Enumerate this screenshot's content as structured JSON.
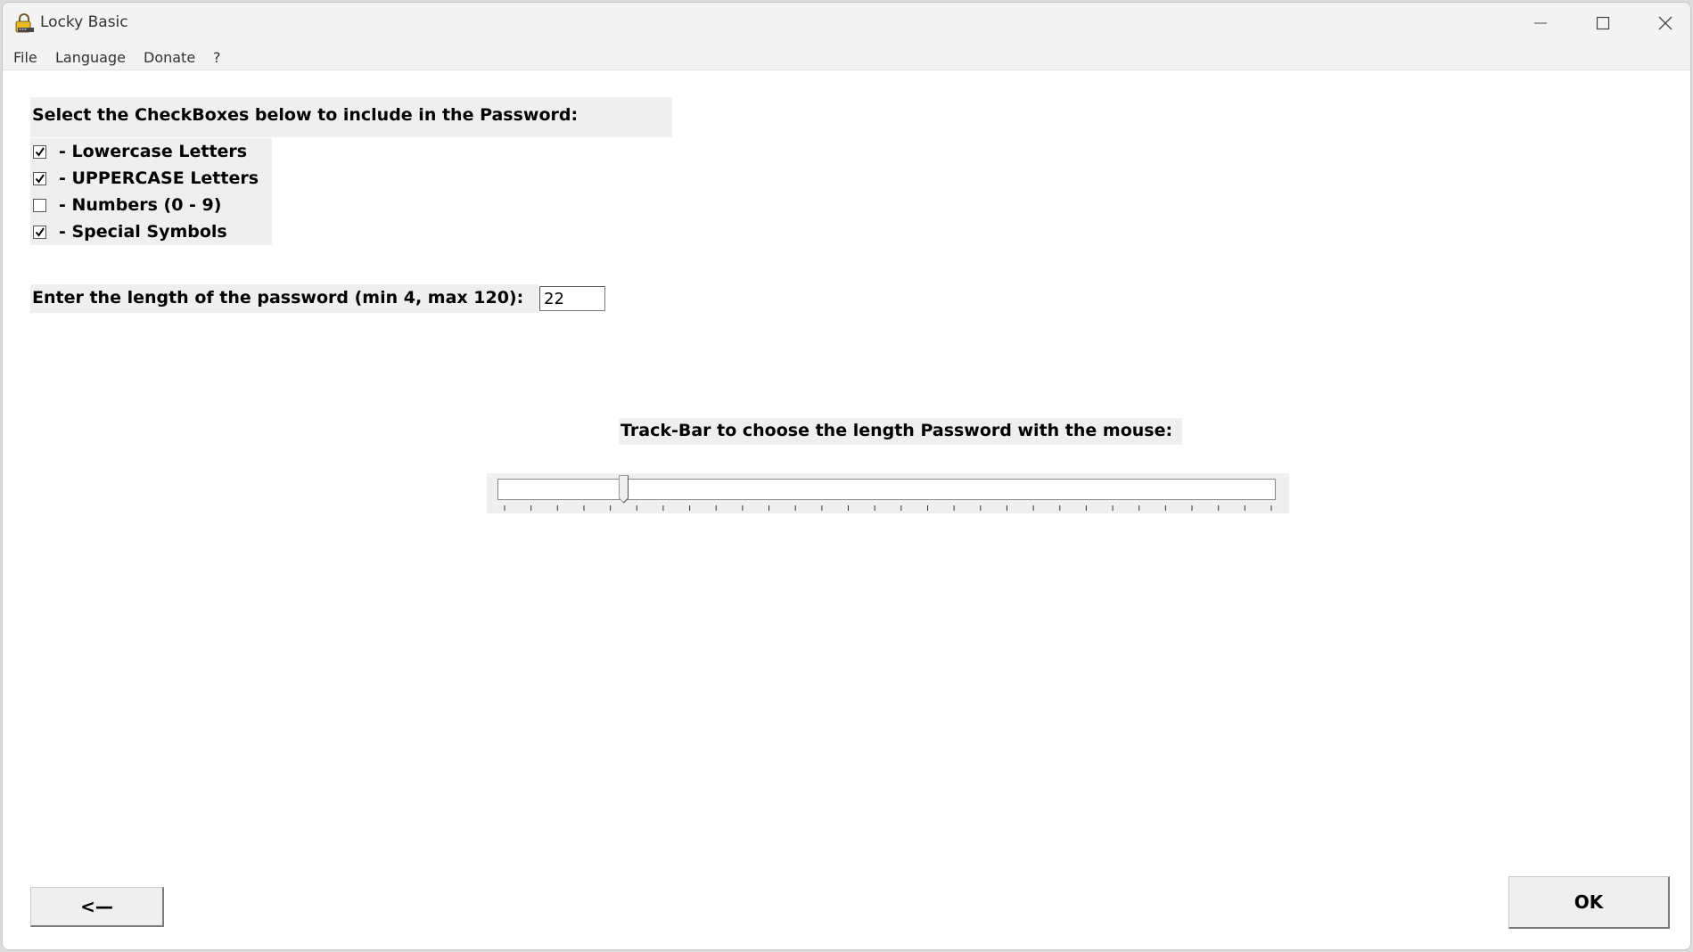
{
  "window": {
    "title": "Locky Basic"
  },
  "menu": [
    "File",
    "Language",
    "Donate",
    "?"
  ],
  "checkbox_section": {
    "heading": "Select the CheckBoxes below to include in the Password:",
    "items": [
      {
        "label": "-  Lowercase Letters",
        "checked": true
      },
      {
        "label": "-  UPPERCASE Letters",
        "checked": true
      },
      {
        "label": "-  Numbers (0 - 9)",
        "checked": false
      },
      {
        "label": "-  Special Symbols",
        "checked": true
      }
    ]
  },
  "length": {
    "label": "Enter the length of the password (min 4, max 120):",
    "value": "22",
    "min": 4,
    "max": 120
  },
  "trackbar": {
    "label": "Track-Bar to choose the length Password with the mouse:",
    "value": 22,
    "min": 4,
    "max": 120,
    "tick_count": 30
  },
  "buttons": {
    "back_label": "<—",
    "ok_label": "OK"
  }
}
